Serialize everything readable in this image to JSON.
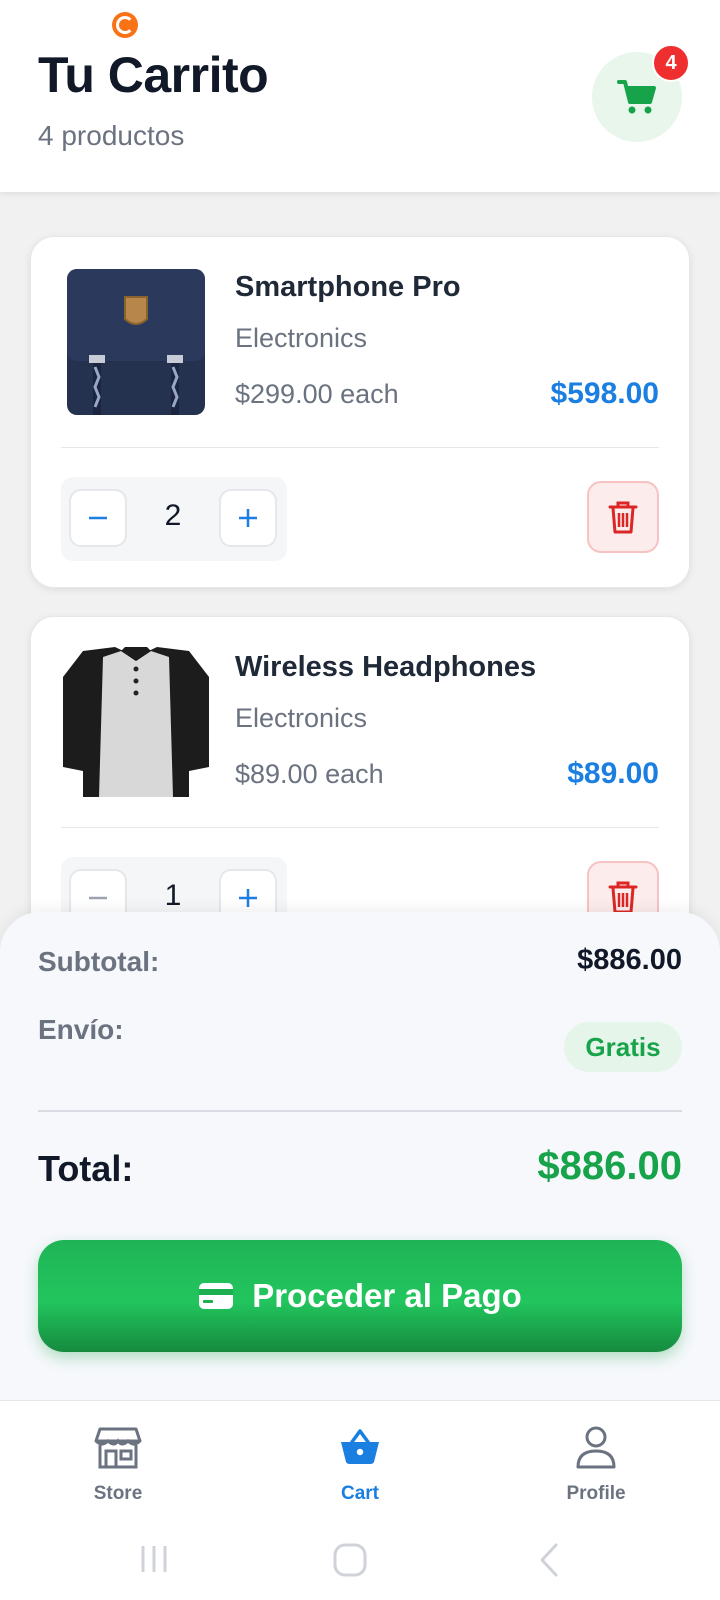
{
  "header": {
    "title": "Tu Carrito",
    "subtitle": "4 productos",
    "cart_badge": "4"
  },
  "cart_items": [
    {
      "name": "Smartphone Pro",
      "category": "Electronics",
      "unit_price": "$299.00 each",
      "line_total": "$598.00",
      "quantity": "2",
      "image_icon": "backpack-image"
    },
    {
      "name": "Wireless Headphones",
      "category": "Electronics",
      "unit_price": "$89.00 each",
      "line_total": "$89.00",
      "quantity": "1",
      "image_icon": "shirt-image"
    }
  ],
  "summary": {
    "subtotal_label": "Subtotal:",
    "subtotal_value": "$886.00",
    "shipping_label": "Envío:",
    "shipping_value": "Gratis",
    "total_label": "Total:",
    "total_value": "$886.00",
    "pay_button": "Proceder al Pago"
  },
  "bottom_nav": {
    "items": [
      {
        "label": "Store",
        "icon": "store-icon",
        "active": false
      },
      {
        "label": "Cart",
        "icon": "basket-icon",
        "active": true
      },
      {
        "label": "Profile",
        "icon": "person-icon",
        "active": false
      }
    ]
  },
  "colors": {
    "accent_blue": "#1a7fe0",
    "accent_green": "#16a34a",
    "danger_red": "#dc2626",
    "badge_red": "#ef2f2f"
  }
}
